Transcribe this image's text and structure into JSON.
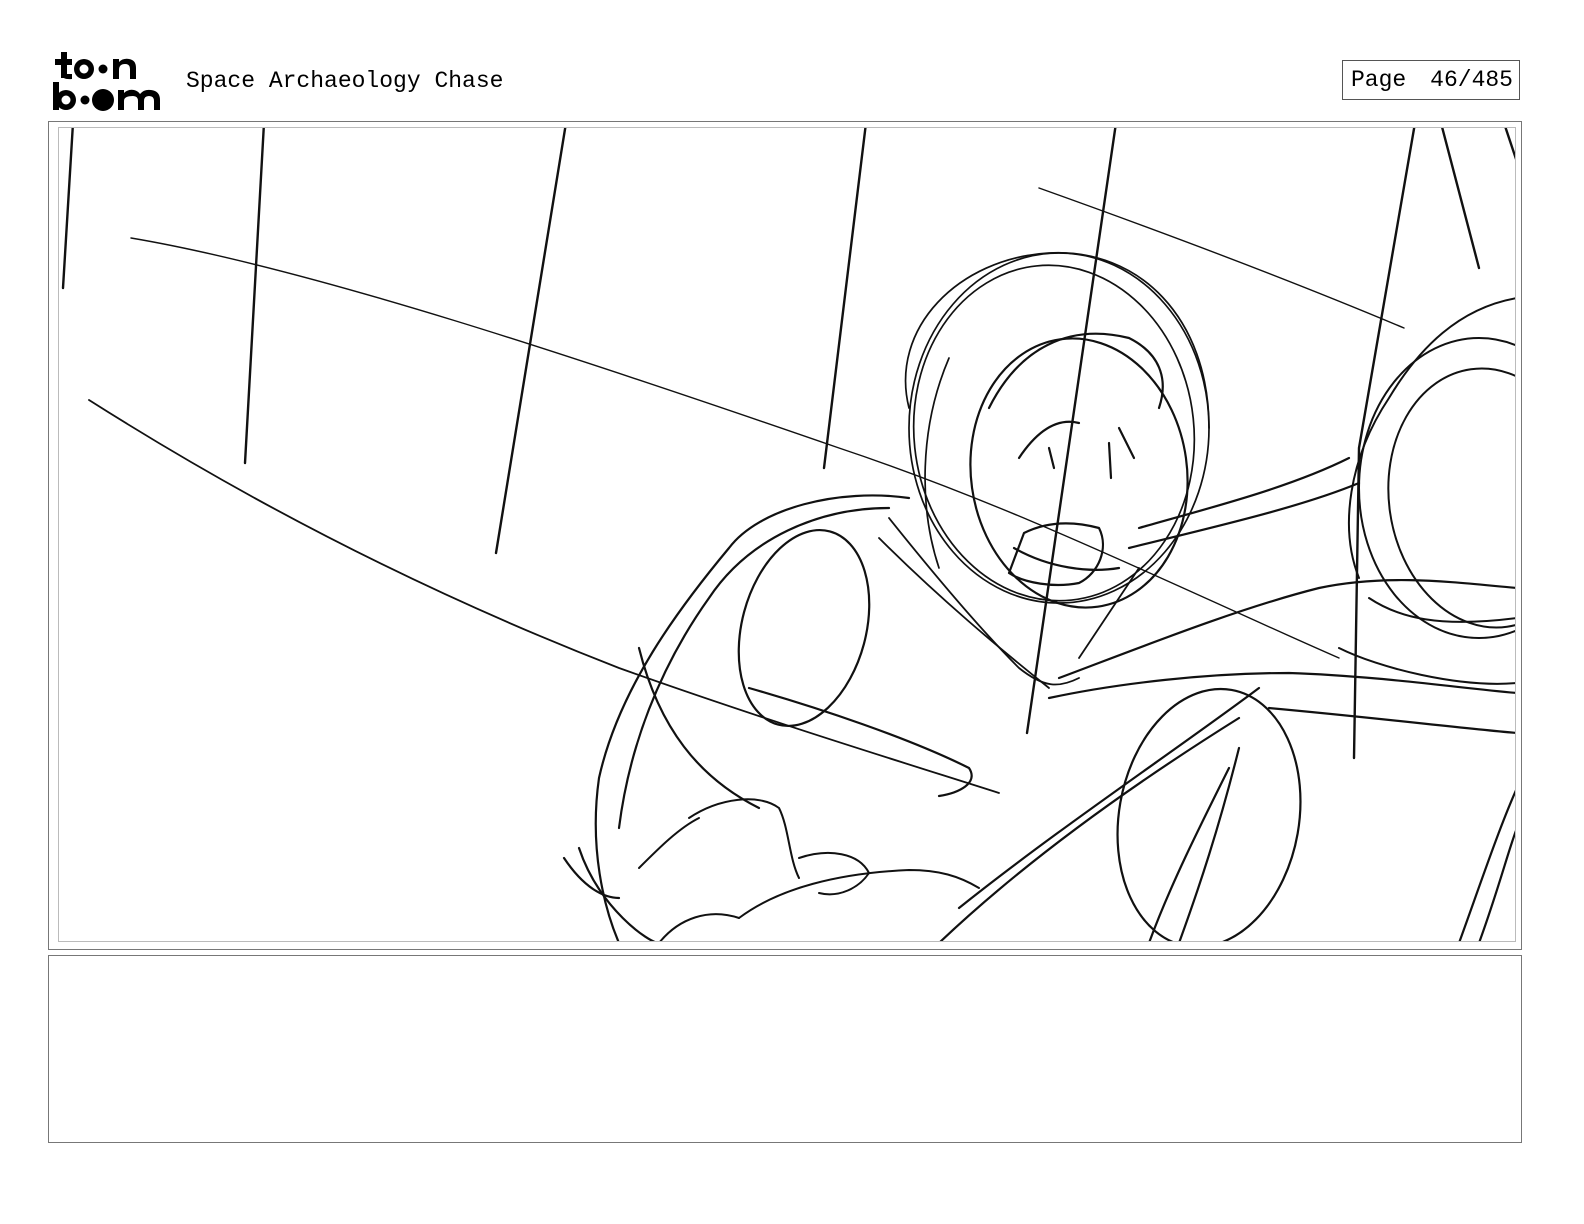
{
  "header": {
    "logo": {
      "line1": "toon",
      "line2": "boom",
      "icon": "toon-boom-logo"
    },
    "title": "Space Archaeology Chase",
    "page_label": "Page",
    "page_number": "46/485"
  },
  "panel": {
    "icon": "storyboard-sketch-astronaut"
  },
  "notes": {
    "text": ""
  }
}
